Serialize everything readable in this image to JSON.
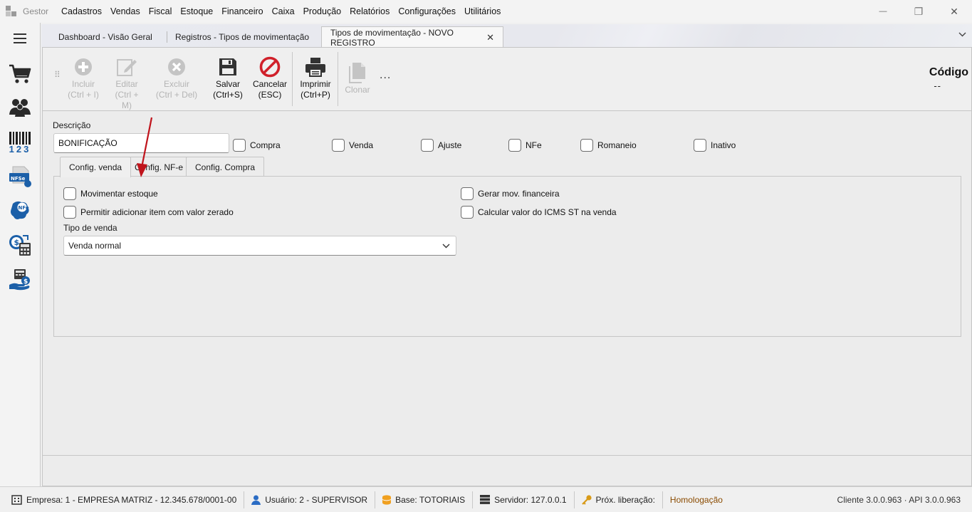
{
  "app": {
    "name": "Gestor",
    "menu": [
      "Cadastros",
      "Vendas",
      "Fiscal",
      "Estoque",
      "Financeiro",
      "Caixa",
      "Produção",
      "Relatórios",
      "Configurações",
      "Utilitários"
    ]
  },
  "window_controls": {
    "minimize": "—",
    "restore": "❐",
    "close": "✕"
  },
  "sidebar": {
    "items": [
      {
        "icon": "hamburger-menu-icon"
      },
      {
        "icon": "shopping-cart-icon"
      },
      {
        "icon": "users-icon"
      },
      {
        "icon": "barcode-icon",
        "text": "123"
      },
      {
        "icon": "nfse-icon",
        "text": "NFSe"
      },
      {
        "icon": "nfe-icon",
        "text": "NFe"
      },
      {
        "icon": "money-calculator-icon"
      },
      {
        "icon": "cash-hand-icon"
      }
    ]
  },
  "tabs": [
    {
      "label": "Dashboard - Visão Geral",
      "active": false
    },
    {
      "label": "Registros - Tipos de movimentação",
      "active": false
    },
    {
      "label": "Tipos de movimentação - NOVO REGISTRO",
      "active": true,
      "close": "✕"
    }
  ],
  "toolbar": {
    "incluir": {
      "label1": "Incluir",
      "label2": "(Ctrl + I)",
      "enabled": false
    },
    "editar": {
      "label1": "Editar",
      "label2": "(Ctrl + M)",
      "enabled": false
    },
    "excluir": {
      "label1": "Excluir",
      "label2": "(Ctrl + Del)",
      "enabled": false
    },
    "salvar": {
      "label1": "Salvar",
      "label2": "(Ctrl+S)",
      "enabled": true
    },
    "cancelar": {
      "label1": "Cancelar",
      "label2": "(ESC)",
      "enabled": true
    },
    "imprimir": {
      "label1": "Imprimir",
      "label2": "(Ctrl+P)",
      "enabled": true
    },
    "clonar": {
      "label1": "Clonar",
      "enabled": false
    },
    "more": "...",
    "codigo_label": "Código",
    "codigo_value": "--"
  },
  "form": {
    "descricao_label": "Descrição",
    "descricao_value": "BONIFICAÇÃO",
    "flags": [
      {
        "label": "Compra",
        "checked": false
      },
      {
        "label": "Venda",
        "checked": false
      },
      {
        "label": "Ajuste",
        "checked": false
      },
      {
        "label": "NFe",
        "checked": false
      },
      {
        "label": "Romaneio",
        "checked": false
      },
      {
        "label": "Inativo",
        "checked": false
      }
    ],
    "inner_tabs": [
      {
        "label": "Config. venda",
        "active": true
      },
      {
        "label": "Config. NF-e",
        "active": false
      },
      {
        "label": "Config. Compra",
        "active": false
      }
    ],
    "venda": {
      "movimentar_estoque": "Movimentar estoque",
      "permitir_item_zerado": "Permitir adicionar item com valor zerado",
      "gerar_mov_financeira": "Gerar mov. financeira",
      "calcular_icms_st": "Calcular valor do ICMS ST na venda",
      "tipo_venda_label": "Tipo de venda",
      "tipo_venda_value": "Venda normal"
    }
  },
  "statusbar": {
    "empresa": "Empresa: 1 - EMPRESA MATRIZ - 12.345.678/0001-00",
    "usuario": "Usuário: 2 - SUPERVISOR",
    "base": "Base: TOTORIAIS",
    "servidor": "Servidor: 127.0.0.1",
    "prox_liberacao": "Próx. liberação:",
    "ambiente": "Homologação",
    "versao": "Cliente 3.0.0.963 · API 3.0.0.963"
  },
  "colors": {
    "accent_red": "#d0202a",
    "disabled_icon": "#c4c4c4",
    "dark_icon": "#333333",
    "sidebar_blue": "#1b5fa8",
    "homolog_text": "#8a4b00",
    "user_icon": "#2b6cc4",
    "db_icon": "#f0a020",
    "key_icon": "#d89a18"
  }
}
